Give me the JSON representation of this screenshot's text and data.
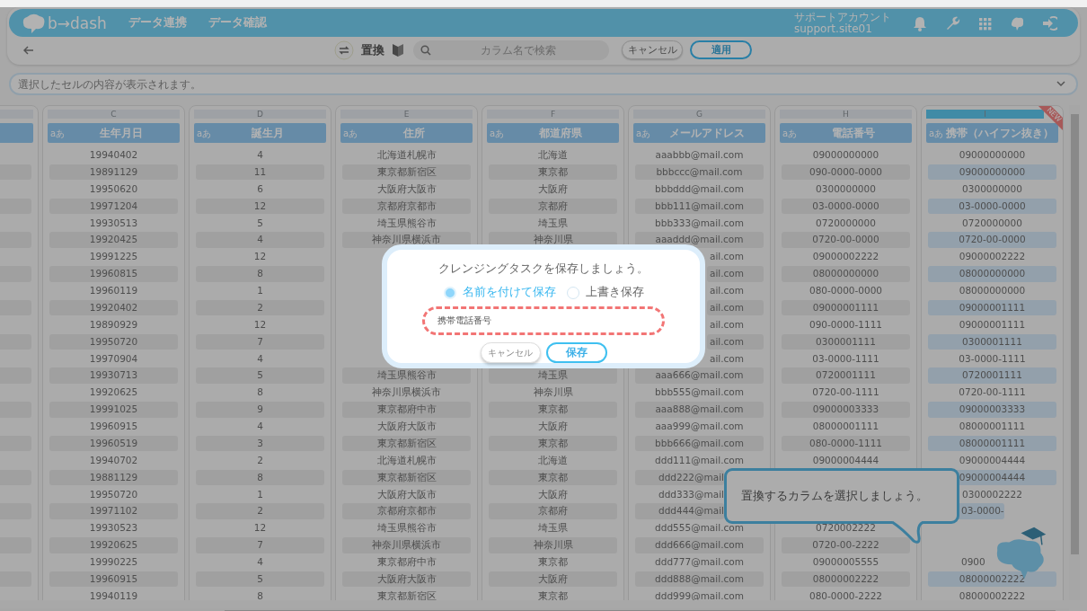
{
  "header": {
    "logo": "b→dash",
    "nav": [
      {
        "label": "データ連携"
      },
      {
        "label": "データ確認"
      }
    ],
    "account": {
      "name": "サポートアカウント",
      "id": "support.site01"
    }
  },
  "toolbar": {
    "mode_label": "置換",
    "search": {
      "placeholder": "カラム名で検索"
    },
    "buttons": [
      {
        "label": "キャンセル",
        "kind": "secondary"
      },
      {
        "label": "適用",
        "kind": "primary"
      }
    ]
  },
  "cell_preview": {
    "placeholder": "選択したセルの内容が表示されます。"
  },
  "columns": [
    {
      "selected": false
    },
    {
      "letter": "C",
      "type_label": "aあ",
      "name": "生年月日",
      "selected": false,
      "cells": [
        "19940402",
        "19891129",
        "19950620",
        "19971204",
        "19930513",
        "19920425",
        "19991225",
        "19960815",
        "19960119",
        "19920402",
        "19890929",
        "19950720",
        "19970904",
        "19930713",
        "19920625",
        "19991025",
        "19960915",
        "19960519",
        "19940702",
        "19881129",
        "19950720",
        "19971102",
        "19930523",
        "19920625",
        "19990225",
        "19960915",
        "19940119"
      ]
    },
    {
      "letter": "D",
      "type_label": "aあ",
      "name": "誕生月",
      "selected": false,
      "cells": [
        "4",
        "11",
        "6",
        "12",
        "5",
        "4",
        "12",
        "8",
        "1",
        "2",
        "12",
        "7",
        "4",
        "5",
        "8",
        "9",
        "4",
        "3",
        "2",
        "8",
        "1",
        "2",
        "12",
        "7",
        "4",
        "5",
        "8"
      ]
    },
    {
      "letter": "E",
      "type_label": "aあ",
      "name": "住所",
      "selected": false,
      "cells": [
        "北海道札幌市",
        "東京都新宿区",
        "大阪府大阪市",
        "京都府京都市",
        "埼玉県熊谷市",
        "神奈川県横浜市",
        null,
        null,
        null,
        null,
        null,
        null,
        null,
        "埼玉県熊谷市",
        "神奈川県横浜市",
        "東京都府中市",
        "大阪府大阪市",
        "東京都新宿区",
        "北海道札幌市",
        "東京都新宿区",
        "大阪府大阪市",
        "京都府京都市",
        "埼玉県熊谷市",
        "神奈川県横浜市",
        "東京都府中市",
        "大阪府大阪市",
        "東京都新宿区"
      ]
    },
    {
      "letter": "F",
      "type_label": "aあ",
      "name": "都道府県",
      "selected": false,
      "cells": [
        "北海道",
        "東京都",
        "大阪府",
        "京都府",
        "埼玉県",
        "神奈川県",
        null,
        null,
        null,
        null,
        null,
        null,
        null,
        "埼玉県",
        "神奈川県",
        "東京都",
        "大阪府",
        "東京都",
        "北海道",
        "東京都",
        "大阪府",
        "京都府",
        "埼玉県",
        "神奈川県",
        "東京都",
        "大阪府",
        "東京都"
      ]
    },
    {
      "letter": "G",
      "type_label": "aあ",
      "name": "メールアドレス",
      "selected": false,
      "cells": [
        "aaabbb@mail.com",
        "bbbccc@mail.com",
        "bbbddd@mail.com",
        "bbb111@mail.com",
        "bbb333@mail.com",
        "aaaddd@mail.com",
        {
          "text": "ail.com",
          "clipped_start": true
        },
        {
          "text": "ail.com",
          "clipped_start": true
        },
        {
          "text": "ail.com",
          "clipped_start": true
        },
        {
          "text": "ail.com",
          "clipped_start": true
        },
        {
          "text": "ail.com",
          "clipped_start": true
        },
        {
          "text": "ail.com",
          "clipped_start": true
        },
        {
          "text": "ail.com",
          "clipped_start": true
        },
        "aaa666@mail.com",
        "bbb555@mail.com",
        "aaa888@mail.com",
        "aaa999@mail.com",
        "bbb666@mail.com",
        "ddd111@mail.com",
        {
          "text": "ddd222@mail",
          "clipped_end": true
        },
        {
          "text": "ddd333@mail",
          "clipped_end": true
        },
        {
          "text": "ddd444@mail",
          "clipped_end": true
        },
        "ddd555@mail.com",
        "ddd666@mail.com",
        "ddd777@mail.com",
        "ddd888@mail.com",
        "ddd999@mail.com"
      ]
    },
    {
      "letter": "H",
      "type_label": "aあ",
      "name": "電話番号",
      "selected": false,
      "cells": [
        "09000000000",
        "090-0000-0000",
        "0300000000",
        "03-0000-0000",
        "0720000000",
        "0720-00-0000",
        "09000002222",
        "08000000000",
        "080-0000-0000",
        "09000001111",
        "090-0000-1111",
        "0300001111",
        "03-0000-1111",
        "0720001111",
        "0720-00-1111",
        "09000003333",
        "08000001111",
        "080-0000-1111",
        "09000004444",
        null,
        null,
        null,
        "0720002222",
        "0720-00-2222",
        "09000005555",
        "08000002222",
        "080-0000-2222"
      ]
    },
    {
      "letter": "I",
      "type_label": "aあ",
      "name": "携帯（ハイフン抜き）",
      "selected": true,
      "badge": "NEW",
      "cells": [
        "09000000000",
        "09000000000",
        "0300000000",
        "03-0000-0000",
        "0720000000",
        "0720-00-0000",
        "09000002222",
        "08000000000",
        "08000000000",
        "09000001111",
        "09000001111",
        "0300001111",
        "03-0000-1111",
        "0720001111",
        "0720-00-1111",
        "09000003333",
        "08000001111",
        "08000001111",
        "09000004444",
        "09000004444",
        "0300002222",
        {
          "text": "03-0000-",
          "clipped_end": true
        },
        null,
        null,
        {
          "text": "0900",
          "clipped_end": true
        },
        "08000002222",
        "08000002222"
      ]
    }
  ],
  "tutorial": {
    "message": "置換するカラムを選択しましょう。"
  },
  "dim_background": true,
  "modal": {
    "title": "クレンジングタスクを保存しましょう。",
    "options": [
      {
        "label": "名前を付けて保存",
        "selected": true
      },
      {
        "label": "上書き保存",
        "selected": false
      }
    ],
    "name_field": {
      "value": "携帯電話番号",
      "highlighted": true
    },
    "buttons": [
      {
        "label": "キャンセル",
        "kind": "secondary"
      },
      {
        "label": "保存",
        "kind": "primary"
      }
    ]
  }
}
